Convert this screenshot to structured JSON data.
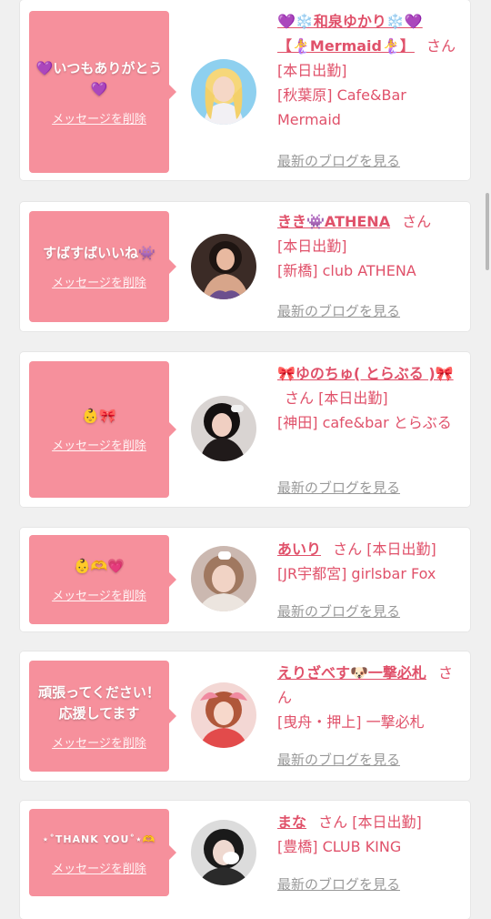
{
  "colors": {
    "accent": "#e0516a",
    "bubble": "#f6909c",
    "link_gray": "#999999"
  },
  "delete_label": "メッセージを削除",
  "blog_label": "最新のブログを見る",
  "san_label": "さん",
  "cards": [
    {
      "message": "💜いつもありがとう💜",
      "name": "💜❄️和泉ゆかり❄️💜【🧜‍♀️Mermaid🧜‍♀️】",
      "status": "[本日出勤]",
      "shop": "[秋葉原] Cafe&Bar Mermaid",
      "avatar_icon": "avatar-photo-blonde"
    },
    {
      "message": "すばすばいいね👾",
      "name": "きき👾ATHENA",
      "status": "[本日出勤]",
      "shop": "[新橋] club ATHENA",
      "avatar_icon": "avatar-photo-dark-hair"
    },
    {
      "message": "👶🎀",
      "name": "🎀ゆのちゅ( とらぶる )🎀",
      "status": "[本日出勤]",
      "shop": "[神田] cafe&bar とらぶる",
      "avatar_icon": "avatar-photo-black-hair"
    },
    {
      "message": "👶🫶💗",
      "name": "あいり",
      "status": "[本日出勤]",
      "shop": "[JR宇都宮] girlsbar Fox",
      "avatar_icon": "avatar-photo-brown-hair"
    },
    {
      "message": "頑張ってください！応援してます",
      "name": "えりざべす🐶一撃必札",
      "status": "",
      "shop": "[曳舟・押上] 一撃必札",
      "avatar_icon": "avatar-photo-pink-bow"
    },
    {
      "message": "⋆˚THANK YOU˚⋆🫶",
      "name": "まな",
      "status": "[本日出勤]",
      "shop": "[豊橋] CLUB KING",
      "avatar_icon": "avatar-photo-dark-hair-2"
    }
  ]
}
